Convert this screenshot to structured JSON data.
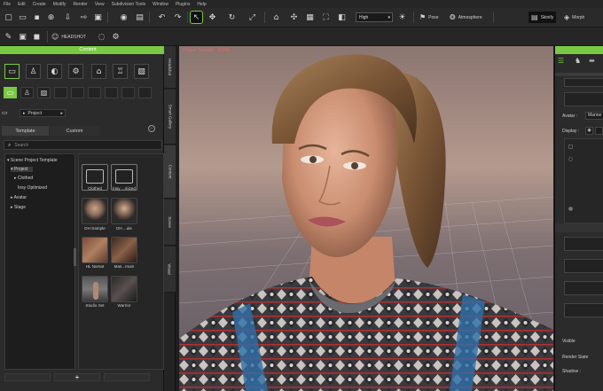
{
  "menu": [
    "File",
    "Edit",
    "Create",
    "Modify",
    "Render",
    "View",
    "Subdivision Tools",
    "Window",
    "Plugins",
    "Help"
  ],
  "toolbar": {
    "quality_value": "High",
    "pose_label": "Pose",
    "atmosphere_label": "Atmosphere",
    "skinify_label": "Skinify",
    "morph_label": "Morph",
    "headshot_label": "HEADSHOT"
  },
  "content_panel": {
    "title": "Content",
    "breadcrumb": "Project",
    "tabs": [
      "Template",
      "Custom"
    ],
    "search_placeholder": "Search",
    "tree": [
      {
        "label": "Scene Project Template",
        "indent": 0,
        "arrow": "▾"
      },
      {
        "label": "Project",
        "indent": 1,
        "arrow": "▾"
      },
      {
        "label": "Clothed",
        "indent": 2,
        "arrow": "▸"
      },
      {
        "label": "Insy Optimized",
        "indent": 2,
        "arrow": ""
      },
      {
        "label": "Avatar",
        "indent": 1,
        "arrow": "▸"
      },
      {
        "label": "Stage",
        "indent": 1,
        "arrow": "▸"
      }
    ],
    "items": [
      "Clothed",
      "Insy ...mized",
      "DH Sample",
      "DH ...ale",
      "HL Narsat",
      "Mas...mum",
      "Studio Set",
      "Warrior"
    ],
    "bottom_plus": "+"
  },
  "vertical_tabs": [
    "Headshot",
    "Smart Gallery",
    "Content",
    "Scene",
    "Visual"
  ],
  "viewport": {
    "overlay": "Project Triangle : 43744"
  },
  "right_panel": {
    "avatar_label": "Avatar :",
    "avatar_value": "Manne",
    "display_label": "Display :",
    "visible_label": "Visible",
    "render_state_label": "Render State",
    "shadow_label": "Shadow :"
  },
  "colors": {
    "accent": "#7ac943",
    "panel": "#2b2b2b"
  }
}
